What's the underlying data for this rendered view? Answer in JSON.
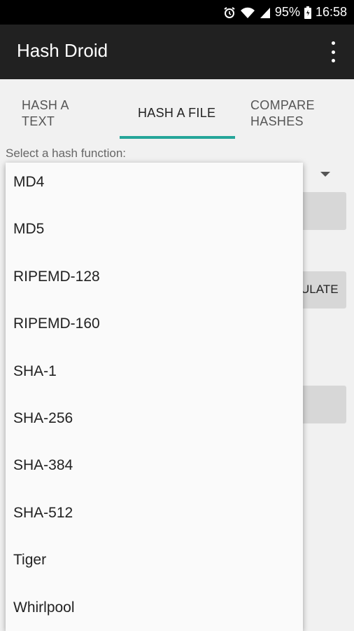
{
  "status_bar": {
    "battery": "95%",
    "time": "16:58"
  },
  "app_bar": {
    "title": "Hash Droid"
  },
  "tabs": [
    {
      "label": "HASH A\nTEXT"
    },
    {
      "label": "HASH A FILE"
    },
    {
      "label": "COMPARE\nHASHES"
    }
  ],
  "hash_select": {
    "label": "Select a hash function:",
    "options": [
      "MD4",
      "MD5",
      "RIPEMD-128",
      "RIPEMD-160",
      "SHA-1",
      "SHA-256",
      "SHA-384",
      "SHA-512",
      "Tiger",
      "Whirlpool"
    ]
  },
  "background_button": {
    "partial_label": "ULATE"
  },
  "colors": {
    "accent": "#26a69a",
    "app_bar": "#212121",
    "status_bar": "#000000"
  }
}
